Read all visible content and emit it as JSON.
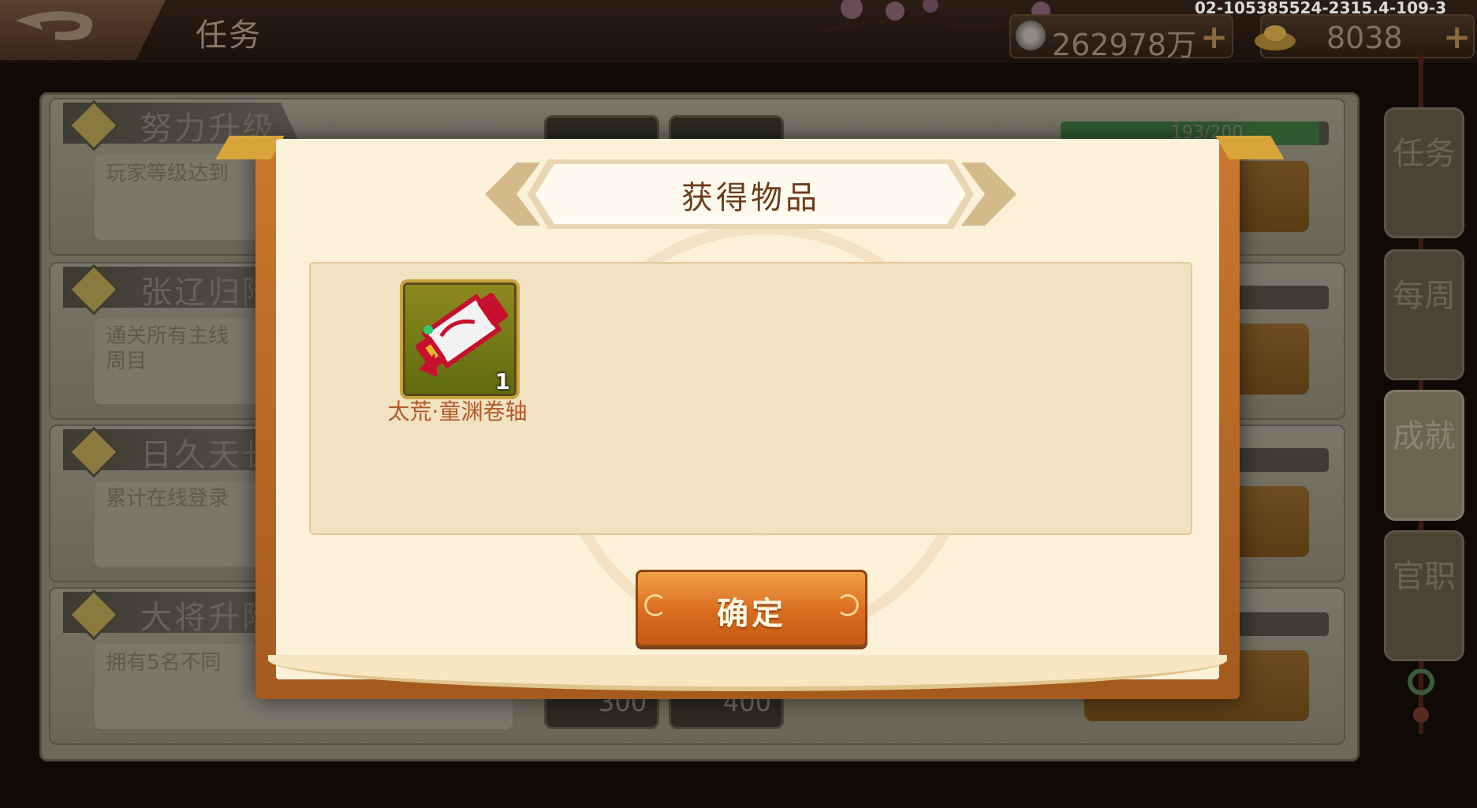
{
  "header": {
    "title": "任务",
    "silver": "262978万",
    "gold": "8038",
    "plus": "+",
    "debug_info": "02-105385524-2315.4-109-3"
  },
  "quests": [
    {
      "title": "努力升级",
      "desc": "玩家等级达到",
      "progress": "193/200",
      "progress_fraction": 0.965
    },
    {
      "title": "张辽归降",
      "desc": "通关所有主线\n周目",
      "progress_fraction": 0.0
    },
    {
      "title": "日久天长",
      "desc": "累计在线登录",
      "progress_fraction": 0.6
    },
    {
      "title": "大将升阶",
      "desc": "拥有5名不同",
      "rewards": [
        "300",
        "400"
      ],
      "progress_fraction": 0.55
    }
  ],
  "side_tabs": [
    {
      "label": "任务",
      "active": false
    },
    {
      "label": "每周",
      "active": false
    },
    {
      "label": "成就",
      "active": true
    },
    {
      "label": "官职",
      "active": false
    }
  ],
  "modal": {
    "title": "获得物品",
    "items": [
      {
        "name": "太荒·童渊卷轴",
        "count": "1",
        "icon": "scroll-icon"
      }
    ],
    "confirm_label": "确定"
  },
  "colors": {
    "modal_frame": "#c9782e",
    "modal_bg": "#fbf0d8",
    "confirm_button": "#d86c1e",
    "item_name": "#b25a2a"
  }
}
